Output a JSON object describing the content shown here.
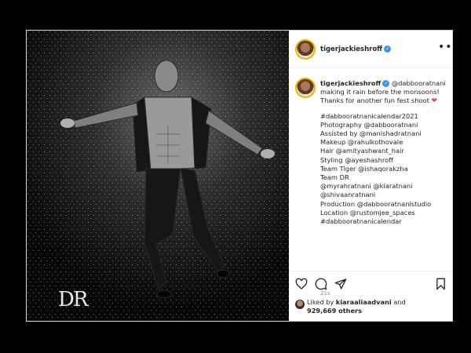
{
  "post": {
    "username": "tigerjackieshroff",
    "verified_icon": "verified-badge-icon",
    "more_icon": "more-options-icon"
  },
  "photo": {
    "description_icon": "photo",
    "watermark": "DR"
  },
  "caption": {
    "username": "tigerjackieshroff",
    "mention_inline": "@dabbooratnani",
    "lines": [
      "making it rain before the monsoons!",
      "Thanks for another fun fest shoot",
      "",
      "#dabbooratnanicalendar2021",
      "Photography @dabbooratnani",
      "Assisted by @manishadratnani",
      "Makeup @rahulkothovale",
      "Hair @amityashwant_hair",
      "Styling @ayeshashroff",
      "Team Tiger @ishaqorakzha",
      "Team DR",
      "@myrahratnani @kiaratnani",
      "@shivaanratnani",
      "Production @dabbooratnanistudio",
      "Location @rustomjee_spaces",
      "#dabbooratnanicalendar"
    ],
    "heart_glyph": "❤",
    "timestamp": "21s"
  },
  "actions": {
    "like_icon": "heart-outline-icon",
    "comment_icon": "comment-icon",
    "share_icon": "share-paper-plane-icon",
    "save_icon": "bookmark-icon"
  },
  "likes": {
    "prefix": "Liked by ",
    "by_user": "kiaraaliaadvani",
    "connector": " and",
    "count": "929,669 others"
  },
  "colors": {
    "background": "#000000",
    "panel": "#ffffff",
    "text": "#262626",
    "muted": "#8e8e8e",
    "verified": "#3897f0",
    "heart": "#ed4956",
    "story_ring": "#f0b400"
  }
}
